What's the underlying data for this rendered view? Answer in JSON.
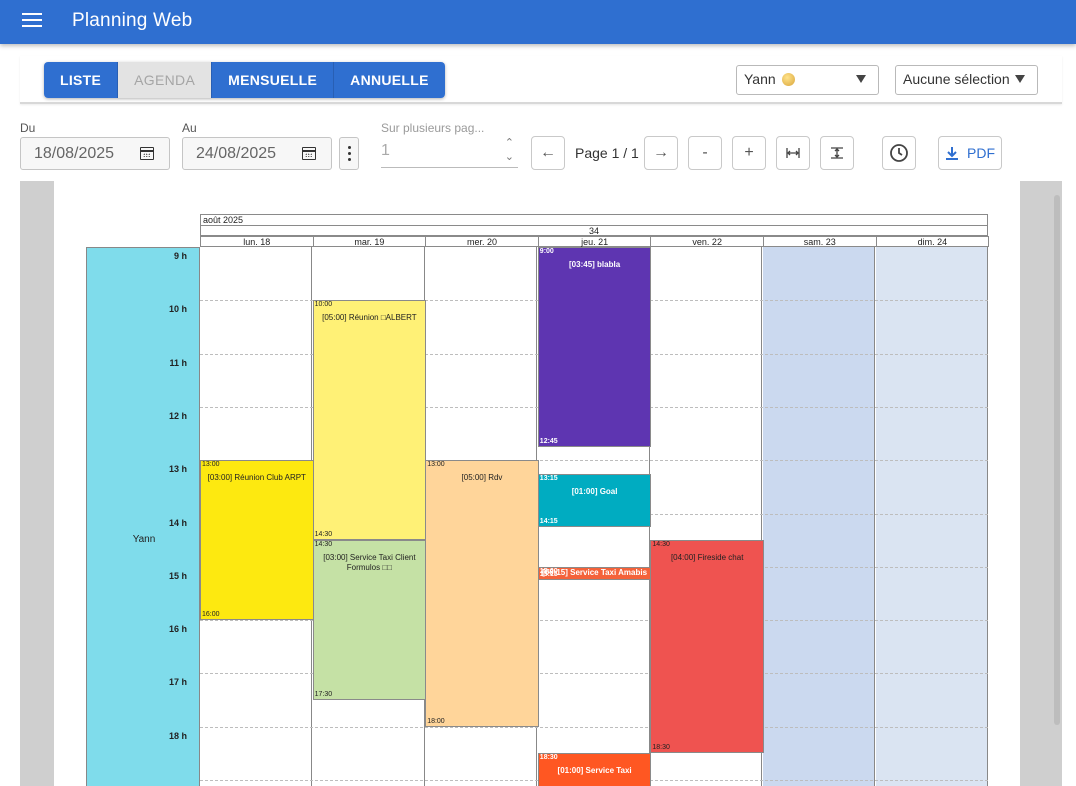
{
  "app": {
    "title": "Planning Web"
  },
  "views": [
    {
      "label": "LISTE",
      "state": "active"
    },
    {
      "label": "AGENDA",
      "state": "selected"
    },
    {
      "label": "MENSUELLE",
      "state": "active"
    },
    {
      "label": "ANNUELLE",
      "state": "active"
    }
  ],
  "user_select": {
    "value": "Yann"
  },
  "selection_select": {
    "value": "Aucune sélection"
  },
  "filters": {
    "from_label": "Du",
    "from_value": "18/08/2025",
    "to_label": "Au",
    "to_value": "24/08/2025",
    "pages_label": "Sur plusieurs pag...",
    "pages_value": "1"
  },
  "pager": {
    "label": "Page 1 / 1",
    "zoom_out": "-",
    "zoom_in": "+"
  },
  "pdf": {
    "label": "PDF"
  },
  "planning": {
    "month": "août 2025",
    "week": "34",
    "days": [
      "lun. 18",
      "mar. 19",
      "mer. 20",
      "jeu. 21",
      "ven. 22",
      "sam. 23",
      "dim. 24"
    ],
    "hours": [
      "9 h",
      "10 h",
      "11 h",
      "12 h",
      "13 h",
      "14 h",
      "15 h",
      "16 h",
      "17 h",
      "18 h"
    ],
    "resource": "Yann",
    "weekend_colors": [
      "#cbd9ef",
      "#dae4f2"
    ],
    "events": [
      {
        "day": 0,
        "start": "13:00",
        "end": "16:00",
        "title": "[03:00] Réunion Club ARPT",
        "color": "#fde910",
        "dark": false
      },
      {
        "day": 1,
        "start": "10:00",
        "end": "14:30",
        "title": "[05:00] Réunion □ALBERT",
        "color": "#fff176",
        "dark": false
      },
      {
        "day": 1,
        "start": "14:30",
        "end": "17:30",
        "title": "[03:00] Service Taxi Client Formulos □□",
        "color": "#c5e1a5",
        "dark": false
      },
      {
        "day": 2,
        "start": "13:00",
        "end": "18:00",
        "title": "[05:00] Rdv",
        "color": "#ffd59a",
        "dark": false
      },
      {
        "day": 3,
        "start": "9:00",
        "end": "12:45",
        "title": "[03:45] blabla",
        "color": "#5e35b1",
        "dark": true
      },
      {
        "day": 3,
        "start": "13:15",
        "end": "14:15",
        "title": "[01:00] Goal",
        "color": "#00acc1",
        "dark": true
      },
      {
        "day": 3,
        "start": "15:00",
        "end": "15:15",
        "title": "[00:15] Service Taxi Amabis",
        "color": "#f4623a",
        "dark": true
      },
      {
        "day": 3,
        "start": "18:30",
        "end": "19:30",
        "title": "[01:00] Service Taxi",
        "color": "#ff5722",
        "dark": true
      },
      {
        "day": 4,
        "start": "14:30",
        "end": "18:30",
        "title": "[04:00] Fireside chat",
        "color": "#ef5350",
        "dark": false
      }
    ]
  }
}
